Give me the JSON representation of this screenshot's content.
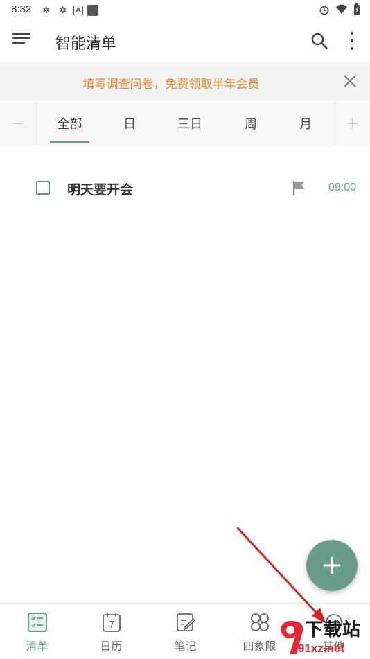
{
  "status_bar": {
    "time": "8:32"
  },
  "toolbar": {
    "title": "智能清单"
  },
  "banner": {
    "text": "填写调查问卷，免费领取半年会员"
  },
  "tabs": {
    "minus": "−",
    "plus": "+",
    "items": [
      {
        "label": "全部",
        "active": true
      },
      {
        "label": "日",
        "active": false
      },
      {
        "label": "三日",
        "active": false
      },
      {
        "label": "周",
        "active": false
      },
      {
        "label": "月",
        "active": false
      }
    ]
  },
  "tasks": [
    {
      "title": "明天要开会",
      "time": "09:00",
      "completed": false
    }
  ],
  "bottom_nav": {
    "items": [
      {
        "label": "清单",
        "icon": "checklist-icon",
        "active": true
      },
      {
        "label": "日历",
        "icon": "calendar-icon",
        "calendar_day": "7",
        "active": false
      },
      {
        "label": "笔记",
        "icon": "note-icon",
        "active": false
      },
      {
        "label": "四象限",
        "icon": "quadrant-icon",
        "active": false
      },
      {
        "label": "其他",
        "icon": "more-apps-icon",
        "active": false
      }
    ]
  },
  "watermark": {
    "brand": "下载站",
    "domain": "91xz.net"
  },
  "colors": {
    "accent": "#6a9c8d",
    "banner_text": "#f0831f",
    "annotation_arrow": "#e02020"
  }
}
